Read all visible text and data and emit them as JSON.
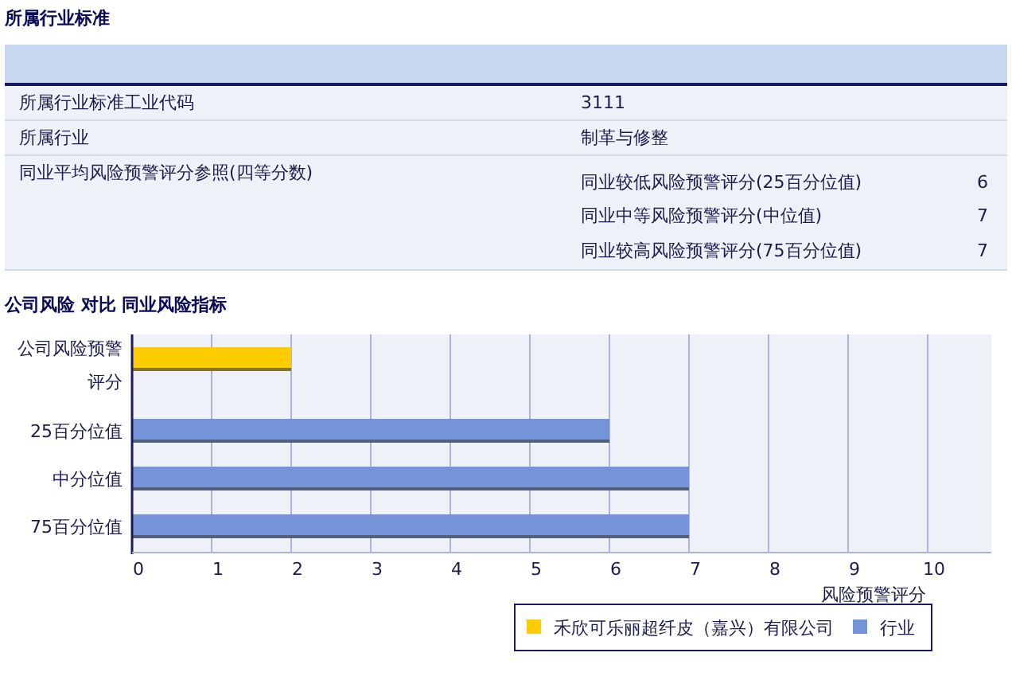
{
  "section_title": "所属行业标准",
  "table": {
    "rows": [
      {
        "label": "所属行业标准工业代码",
        "value": "3111"
      },
      {
        "label": "所属行业",
        "value": "制革与修整"
      },
      {
        "label": "同业平均风险预警评分参照(四等分数)",
        "sub_rows": [
          {
            "label": "同业较低风险预警评分(25百分位值)",
            "value": "6"
          },
          {
            "label": "同业中等风险预警评分(中位值)",
            "value": "7"
          },
          {
            "label": "同业较高风险预警评分(75百分位值)",
            "value": "7"
          }
        ]
      }
    ]
  },
  "chart_section": {
    "title": "公司风险 对比 同业风险指标",
    "chart_data": {
      "type": "bar",
      "orientation": "horizontal",
      "xlabel": "风险预警评分",
      "categories": [
        "公司风险预警评分",
        "25百分位值",
        "中分位值",
        "75百分位值"
      ],
      "series": [
        {
          "name": "禾欣可乐丽超纤皮（嘉兴）有限公司",
          "color": "#ffcc00",
          "values": [
            2,
            null,
            null,
            null
          ]
        },
        {
          "name": "行业",
          "color": "#7593d9",
          "values": [
            null,
            6,
            7,
            7
          ]
        }
      ],
      "xlim": [
        0,
        10.8
      ],
      "grid": {
        "x": true
      },
      "legend": true,
      "xticks": [
        0,
        1,
        2,
        3,
        4,
        5,
        6,
        7,
        8,
        9,
        10
      ]
    }
  }
}
